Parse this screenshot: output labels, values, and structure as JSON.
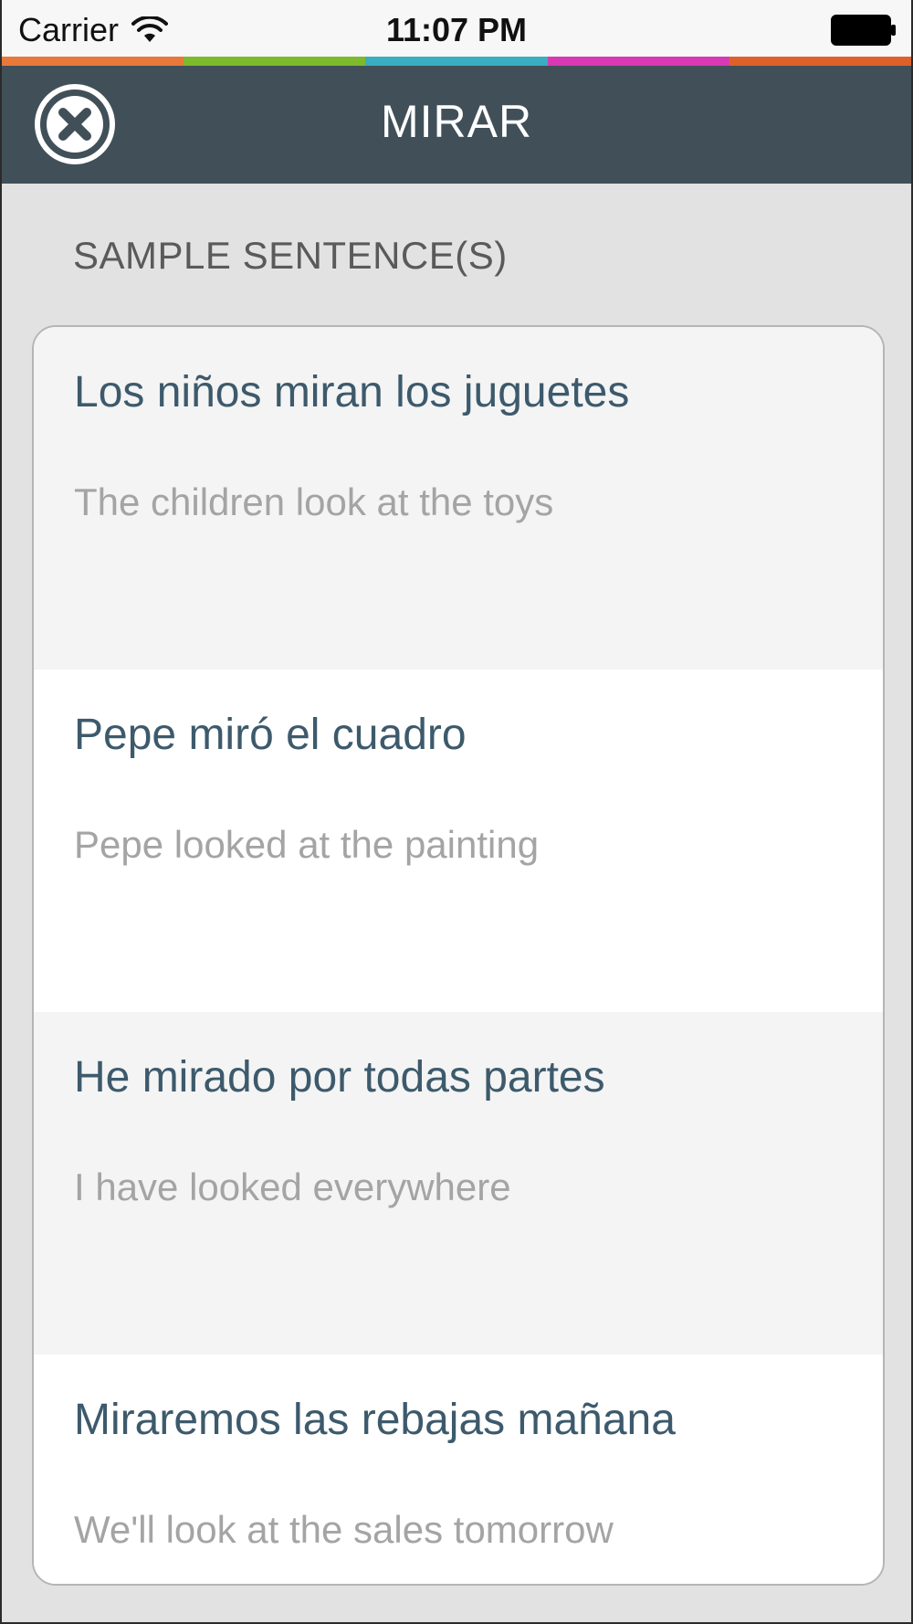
{
  "status_bar": {
    "carrier": "Carrier",
    "time": "11:07 PM",
    "wifi_icon": "wifi-icon",
    "battery_icon": "battery-icon"
  },
  "stripe_colors": [
    "#e8793a",
    "#7dba2c",
    "#3aaec0",
    "#d83ab4",
    "#e0602a"
  ],
  "nav": {
    "title": "MIRAR",
    "close_icon": "close-icon",
    "background": "#415058"
  },
  "section": {
    "header": "SAMPLE SENTENCE(S)"
  },
  "sentences": [
    {
      "spanish": "Los niños miran los juguetes",
      "english": "The children look at the toys"
    },
    {
      "spanish": "Pepe miró el cuadro",
      "english": "Pepe looked at the painting"
    },
    {
      "spanish": "He mirado por todas partes",
      "english": "I have looked everywhere"
    },
    {
      "spanish": "Miraremos las rebajas mañana",
      "english": "We'll look at the sales tomorrow"
    }
  ],
  "colors": {
    "spanish_text": "#3d5a6c",
    "english_text": "#a4a4a4",
    "shaded_row": "#f4f4f4"
  }
}
